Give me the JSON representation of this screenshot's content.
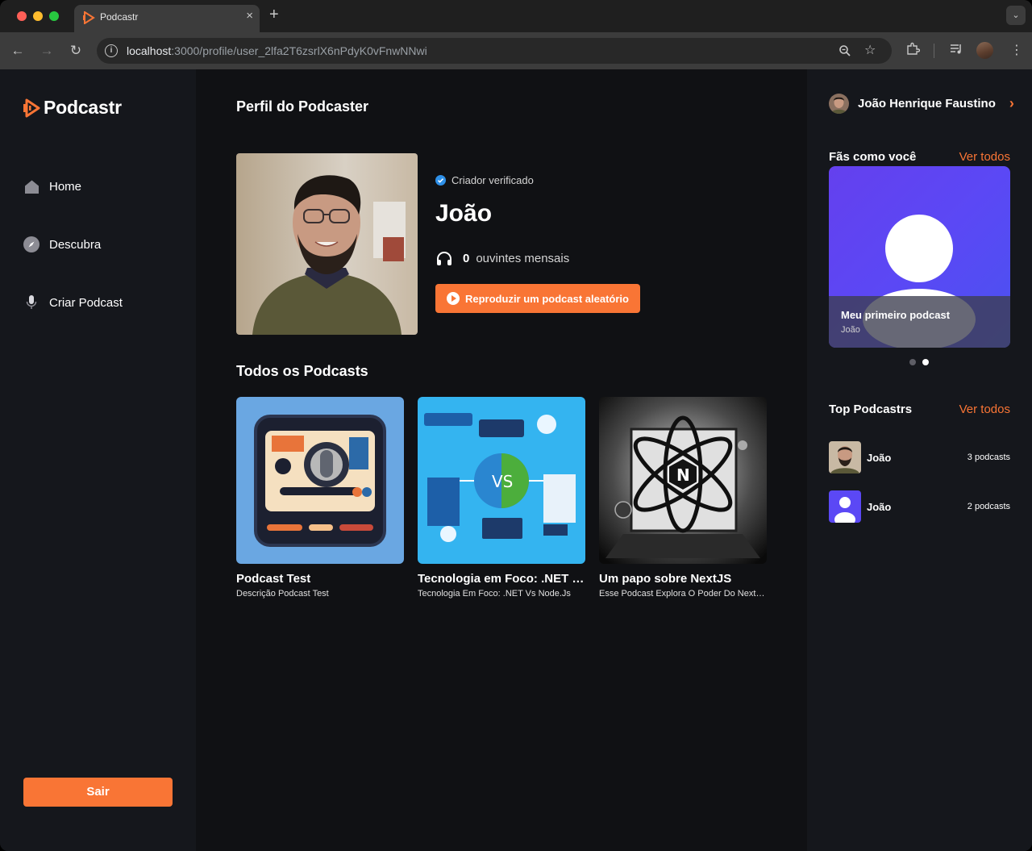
{
  "browser": {
    "tab_title": "Podcastr",
    "url_host": "localhost",
    "url_path": ":3000/profile/user_2lfa2T6zsrlX6nPdyK0vFnwNNwi"
  },
  "app": {
    "brand": "Podcastr",
    "accent_color": "#f97535"
  },
  "sidebar": {
    "items": [
      {
        "label": "Home",
        "icon": "home-icon"
      },
      {
        "label": "Descubra",
        "icon": "compass-icon"
      },
      {
        "label": "Criar Podcast",
        "icon": "microphone-icon"
      }
    ],
    "logout_label": "Sair"
  },
  "profile": {
    "page_title": "Perfil do Podcaster",
    "verified_label": "Criador verificado",
    "name": "João",
    "listeners_count": "0",
    "listeners_label": "ouvintes mensais",
    "random_button": "Reproduzir um podcast aleatório"
  },
  "podcasts": {
    "section_title": "Todos os Podcasts",
    "items": [
      {
        "title": "Podcast Test",
        "description": "Descrição Podcast Test"
      },
      {
        "title": "Tecnologia em Foco: .NET vs Node.js",
        "description": "Tecnologia Em Foco: .NET Vs Node.Js"
      },
      {
        "title": "Um papo sobre NextJS",
        "description": "Esse Podcast Explora O Poder Do Next.Js"
      }
    ]
  },
  "right_sidebar": {
    "user_name": "João Henrique Faustino",
    "fans_title": "Fãs como você",
    "see_all": "Ver todos",
    "carousel": {
      "title": "Meu primeiro podcast",
      "author": "João",
      "active_index": 1,
      "slides": 2
    },
    "top_title": "Top Podcastrs",
    "top": [
      {
        "name": "João",
        "count": "3 podcasts"
      },
      {
        "name": "João",
        "count": "2 podcasts"
      }
    ]
  }
}
